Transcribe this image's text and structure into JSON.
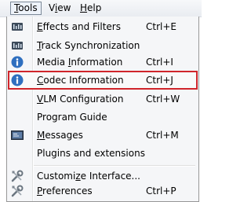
{
  "menubar": {
    "items": [
      {
        "label": "Tools",
        "active": true
      },
      {
        "label": "View"
      },
      {
        "label": "Help"
      }
    ]
  },
  "menu": {
    "items": [
      {
        "label": "Effects and Filters",
        "shortcut": "Ctrl+E",
        "icon": "equalizer-icon"
      },
      {
        "label": "Track Synchronization",
        "shortcut": "",
        "icon": "equalizer-icon"
      },
      {
        "label": "Media Information",
        "shortcut": "Ctrl+I",
        "icon": "info-icon"
      },
      {
        "label": "Codec Information",
        "shortcut": "Ctrl+J",
        "icon": "info-icon",
        "highlighted": true
      },
      {
        "label": "VLM Configuration",
        "shortcut": "Ctrl+W",
        "icon": ""
      },
      {
        "label": "Program Guide",
        "shortcut": "",
        "icon": ""
      },
      {
        "label": "Messages",
        "shortcut": "Ctrl+M",
        "icon": "terminal-icon"
      },
      {
        "label": "Plugins and extensions",
        "shortcut": "",
        "icon": ""
      },
      {
        "label": "Customize Interface...",
        "shortcut": "",
        "icon": "tools-icon"
      },
      {
        "label": "Preferences",
        "shortcut": "Ctrl+P",
        "icon": "tools-icon"
      }
    ]
  },
  "colors": {
    "highlight_border": "#d0252a",
    "info_icon": "#2f6fbf"
  }
}
